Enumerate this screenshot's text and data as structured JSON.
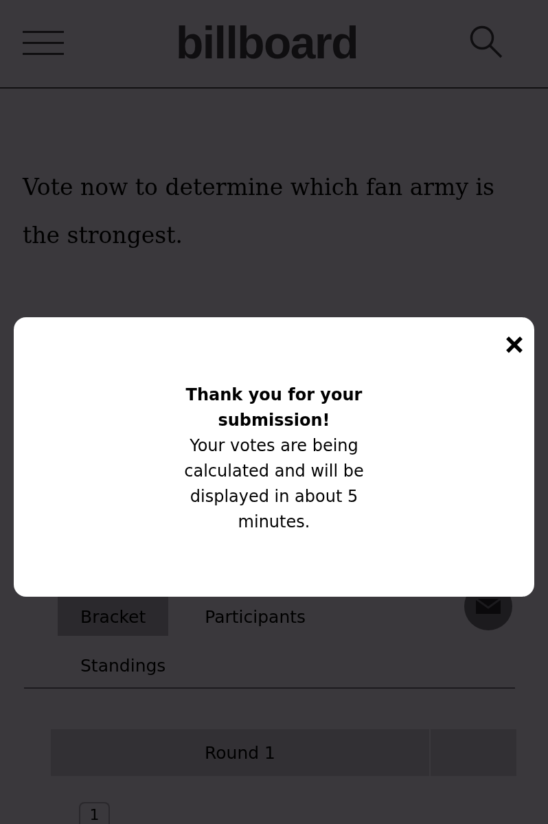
{
  "header": {
    "logo": "billboard"
  },
  "intro": {
    "text": "Vote now to determine which fan army is the strongest."
  },
  "modal": {
    "title": "Thank you for your submission!",
    "message": "Your votes are being calculated and will be displayed in about 5 minutes."
  },
  "tabs": [
    {
      "label": "Bracket",
      "selected": true
    },
    {
      "label": "Participants",
      "selected": false
    },
    {
      "label": "Standings",
      "selected": false
    }
  ],
  "round_bar": {
    "label": "Round 1"
  },
  "matchup": {
    "seed": "1"
  }
}
